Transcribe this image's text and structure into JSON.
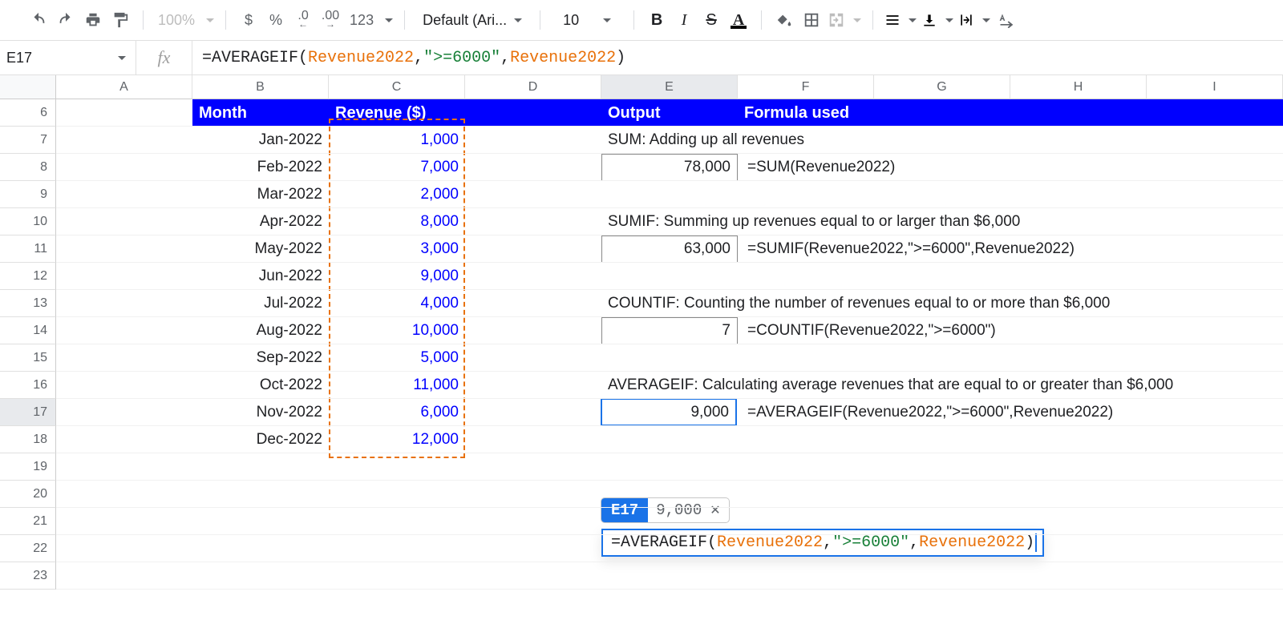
{
  "toolbar": {
    "zoom": "100%",
    "currency": "$",
    "percent": "%",
    "dec_dec": ".0",
    "dec_inc": ".00",
    "more_formats": "123",
    "font": "Default (Ari...",
    "font_size": "10"
  },
  "namebox": "E17",
  "formula": {
    "prefix": "=AVERAGEIF(",
    "arg1": "Revenue2022",
    "comma1": ",",
    "arg2": "\">=6000\"",
    "comma2": ",",
    "arg3": "Revenue2022",
    "suffix": ")"
  },
  "columns": [
    "A",
    "B",
    "C",
    "D",
    "E",
    "F",
    "G",
    "H",
    "I"
  ],
  "row_start": 6,
  "row_end": 23,
  "active_row": 17,
  "active_col": "E",
  "headers": {
    "month": "Month",
    "revenue": "Revenue ($)",
    "output": "Output",
    "formula_used": "Formula used"
  },
  "months": [
    "Jan-2022",
    "Feb-2022",
    "Mar-2022",
    "Apr-2022",
    "May-2022",
    "Jun-2022",
    "Jul-2022",
    "Aug-2022",
    "Sep-2022",
    "Oct-2022",
    "Nov-2022",
    "Dec-2022"
  ],
  "revenues": [
    "1,000",
    "7,000",
    "2,000",
    "8,000",
    "3,000",
    "9,000",
    "4,000",
    "10,000",
    "5,000",
    "11,000",
    "6,000",
    "12,000"
  ],
  "sections": {
    "sum_label": "SUM: Adding up all revenues",
    "sum_value": "78,000",
    "sum_formula": "=SUM(Revenue2022)",
    "sumif_label": "SUMIF: Summing up revenues equal to or larger than $6,000",
    "sumif_value": "63,000",
    "sumif_formula": "=SUMIF(Revenue2022,\">=6000\",Revenue2022)",
    "countif_label": "COUNTIF: Counting the number of revenues equal to or more than $6,000",
    "countif_value": "7",
    "countif_formula": "=COUNTIF(Revenue2022,\">=6000\")",
    "avgif_label": "AVERAGEIF: Calculating average revenues that are equal to or greater than $6,000",
    "avgif_value": "9,000",
    "avgif_formula": "=AVERAGEIF(Revenue2022,\">=6000\",Revenue2022)"
  },
  "edit_popup": {
    "ref": "E17",
    "value": "9,000",
    "formula_prefix": "=AVERAGEIF(",
    "arg1": "Revenue2022",
    "comma1": ",",
    "arg2": "\">=6000\"",
    "comma2": ",",
    "arg3": "Revenue2022",
    "suffix": ")"
  }
}
